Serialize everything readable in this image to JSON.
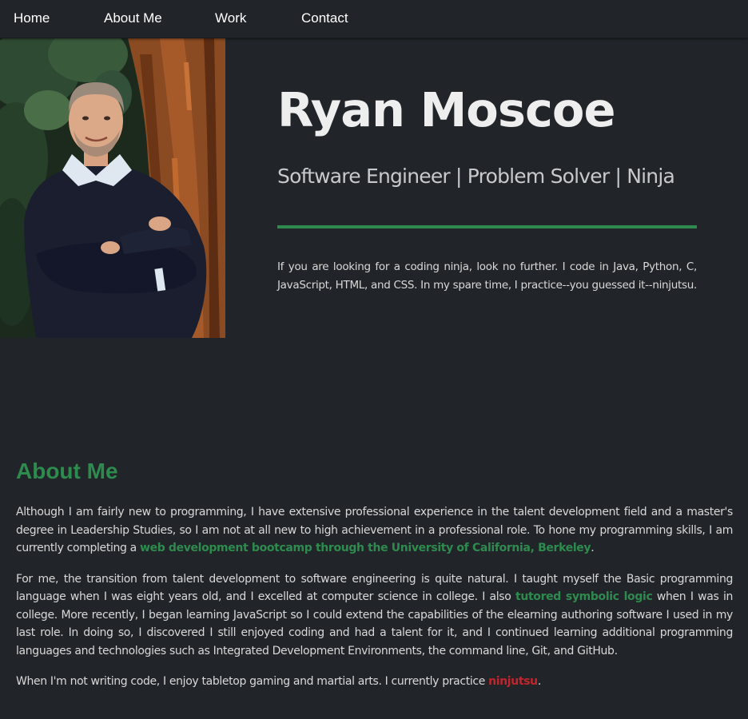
{
  "nav": {
    "items": [
      {
        "label": "Home"
      },
      {
        "label": "About Me"
      },
      {
        "label": "Work"
      },
      {
        "label": "Contact"
      }
    ]
  },
  "hero": {
    "name": "Ryan Moscoe",
    "subtitle": "Software Engineer | Problem Solver | Ninja",
    "blurb": "If you are looking for a coding ninja, look no further. I code in Java, Python, C, JavaScript, HTML, and CSS. In my spare time, I practice--you guessed it--ninjutsu.",
    "photo_icon": "portrait-photo"
  },
  "about": {
    "title": "About Me",
    "p1_a": "Although I am fairly new to programming, I have extensive professional experience in the talent development field and a master's degree in Leadership Studies, so I am not at all new to high achievement in a professional role. To hone my programming skills, I am currently completing a ",
    "p1_link": "web development bootcamp through the University of California, Berkeley",
    "p1_b": ".",
    "p2_a": "For me, the transition from talent development to software engineering is quite natural. I taught myself the Basic programming language when I was eight years old, and I excelled at computer science in college. I also ",
    "p2_link": "tutored symbolic logic",
    "p2_b": " when I was in college. More recently, I began learning JavaScript so I could extend the capabilities of the elearning authoring software I used in my last role. In doing so, I discovered I still enjoyed coding and had a talent for it, and I continued learning additional programming languages and technologies such as Integrated Development Environments, the command line, Git, and GitHub.",
    "p3_a": "When I'm not writing code, I enjoy tabletop gaming and martial arts. I currently practice ",
    "p3_link": "ninjutsu",
    "p3_b": "."
  },
  "colors": {
    "background": "#212529",
    "accent_green": "#2e8b4e",
    "accent_red": "#c0272d",
    "text": "#d8d8d8"
  }
}
